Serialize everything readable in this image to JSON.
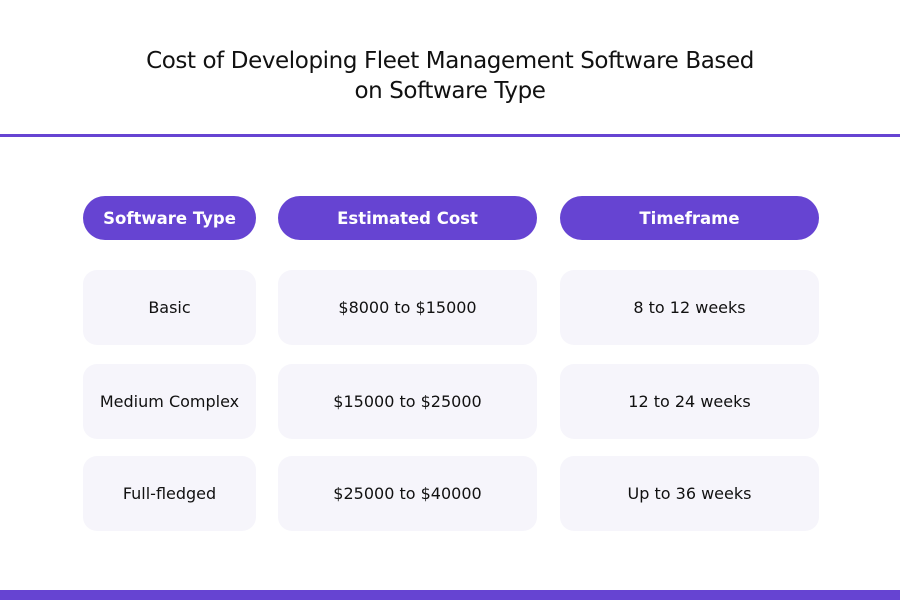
{
  "title": {
    "line1": "Cost of Developing Fleet Management Software Based",
    "line2": "on Software Type"
  },
  "table": {
    "headers": [
      "Software Type",
      "Estimated Cost",
      "Timeframe"
    ],
    "rows": [
      [
        "Basic",
        "$8000 to $15000",
        "8 to 12 weeks"
      ],
      [
        "Medium Complex",
        "$15000 to $25000",
        "12 to 24 weeks"
      ],
      [
        "Full-fledged",
        "$25000 to $40000",
        "Up to 36 weeks"
      ]
    ]
  },
  "colors": {
    "accent": "#6644d2",
    "cell_background": "#f6f5fb",
    "text": "#111111"
  }
}
